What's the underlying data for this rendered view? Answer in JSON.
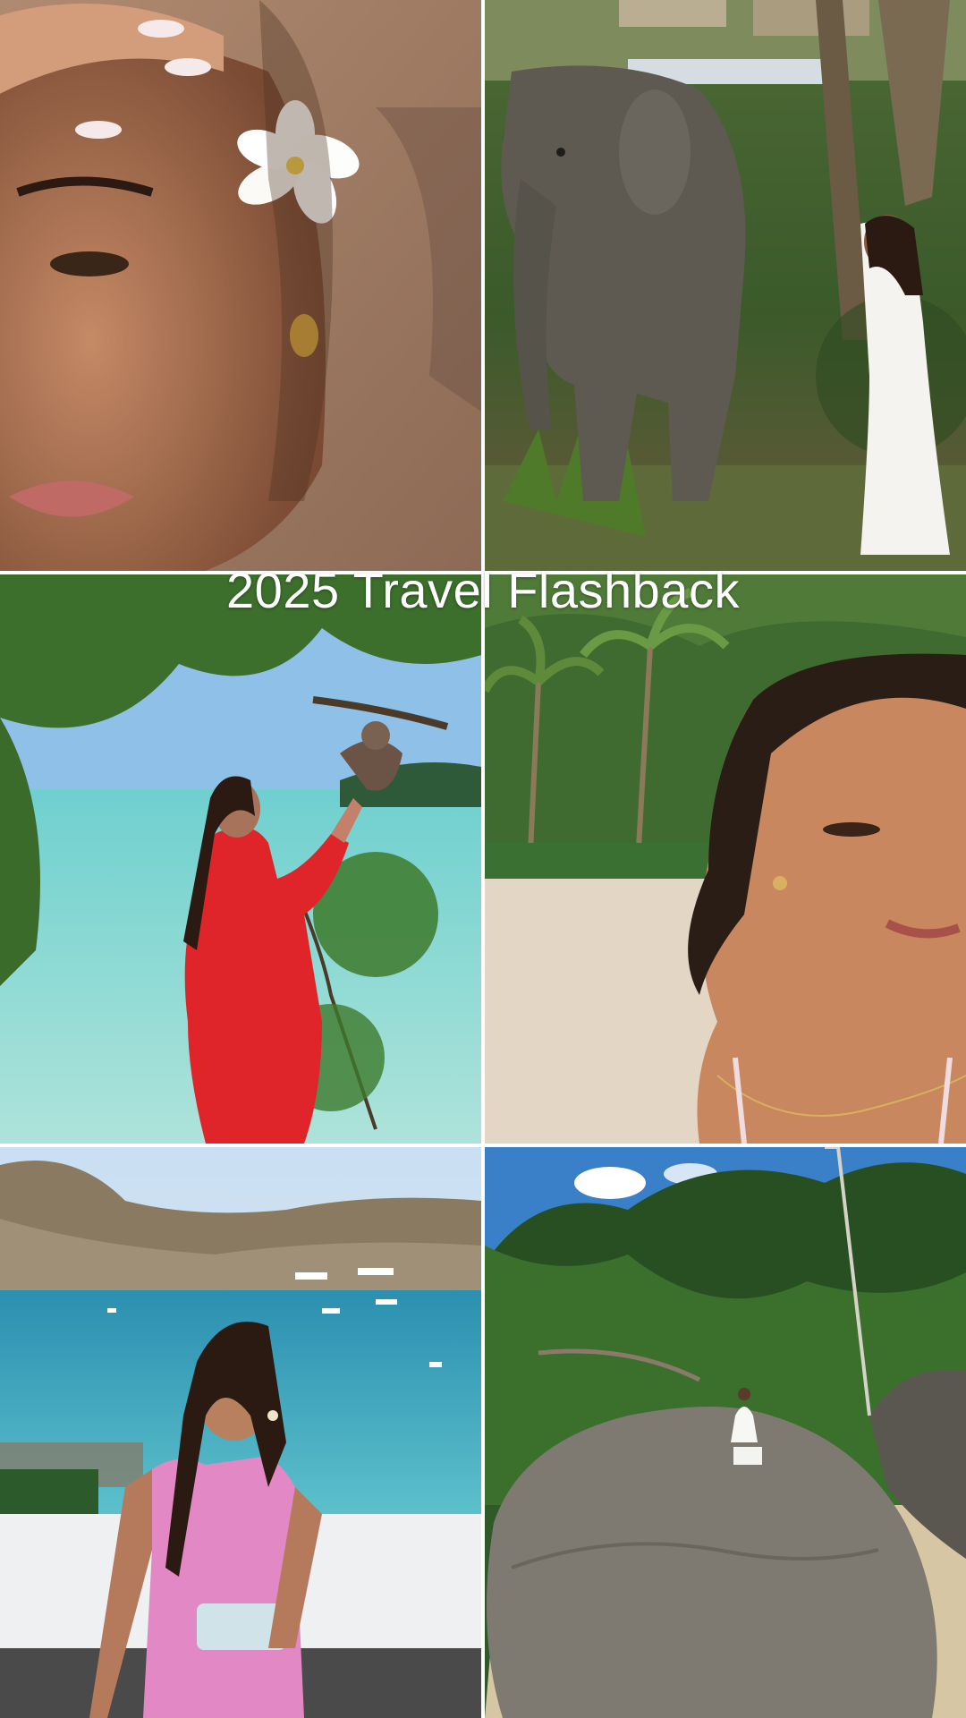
{
  "title": "2025 Travel Flashback",
  "colors": {
    "divider": "#ffffff",
    "title_text": "#ffffff"
  },
  "tiles": [
    {
      "scene": "closeup-portrait-with-plumeria-flower"
    },
    {
      "scene": "woman-in-white-dress-beside-elephant"
    },
    {
      "scene": "woman-in-red-dress-with-monkey-by-sea"
    },
    {
      "scene": "beach-selfie-with-palm-trees"
    },
    {
      "scene": "woman-in-pink-dress-overlooking-bay"
    },
    {
      "scene": "woman-sitting-on-boulder-in-jungle"
    }
  ]
}
